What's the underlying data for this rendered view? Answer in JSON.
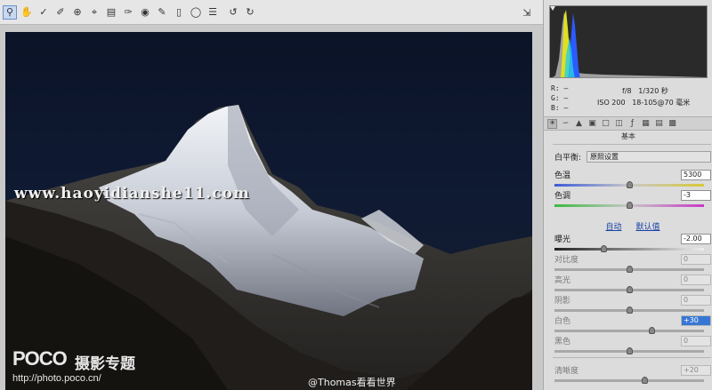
{
  "toolbar": {
    "icons": [
      "zoom-icon",
      "hand-icon",
      "white-balance-icon",
      "color-sampler-icon",
      "target-adjust-icon",
      "crop-icon",
      "straighten-icon",
      "spot-removal-icon",
      "red-eye-icon",
      "adjustment-brush-icon",
      "graduated-filter-icon",
      "radial-filter-icon",
      "list-icon",
      "rotate-left-icon",
      "rotate-right-icon"
    ],
    "fullscreen_icon": "fullscreen-icon"
  },
  "photo": {
    "watermark_site": "www.haoyidianshe11.com",
    "logo_brand": "POCO",
    "logo_cn": "摄影专题",
    "logo_url": "http://photo.poco.cn/",
    "author": "@Thomas看看世界"
  },
  "histogram": {
    "r_label": "R:",
    "g_label": "G:",
    "b_label": "B:",
    "r_value": "—",
    "g_value": "—",
    "b_value": "—",
    "colors": {
      "blue": "#2a5cff",
      "yellow": "#e0e020",
      "cyan": "#28d0e0",
      "gray": "#a0a0a0"
    }
  },
  "exif": {
    "aperture": "f/8",
    "shutter": "1/320 秒",
    "iso": "ISO 200",
    "focal": "18-105@70 毫米"
  },
  "panel": {
    "section_title": "基本",
    "white_balance_label": "白平衡:",
    "white_balance_value": "原照设置",
    "auto_label": "自动",
    "default_label": "默认值",
    "sliders": [
      {
        "name": "temperature",
        "label": "色温",
        "value": "5300",
        "pos": 0.5,
        "dim": false,
        "selected": false
      },
      {
        "name": "tint",
        "label": "色调",
        "value": "-3",
        "pos": 0.5,
        "dim": false,
        "selected": false
      },
      {
        "name": "exposure",
        "label": "曝光",
        "value": "-2.00",
        "pos": 0.33,
        "dim": false,
        "selected": false
      },
      {
        "name": "contrast",
        "label": "对比度",
        "value": "0",
        "pos": 0.5,
        "dim": true,
        "selected": false
      },
      {
        "name": "highlights",
        "label": "高光",
        "value": "0",
        "pos": 0.5,
        "dim": true,
        "selected": false
      },
      {
        "name": "shadows",
        "label": "阴影",
        "value": "0",
        "pos": 0.5,
        "dim": true,
        "selected": false
      },
      {
        "name": "whites",
        "label": "白色",
        "value": "+30",
        "pos": 0.65,
        "dim": true,
        "selected": true
      },
      {
        "name": "blacks",
        "label": "黑色",
        "value": "0",
        "pos": 0.5,
        "dim": true,
        "selected": false
      },
      {
        "name": "clarity",
        "label": "清晰度",
        "value": "+20",
        "pos": 0.6,
        "dim": true,
        "selected": false
      }
    ]
  }
}
